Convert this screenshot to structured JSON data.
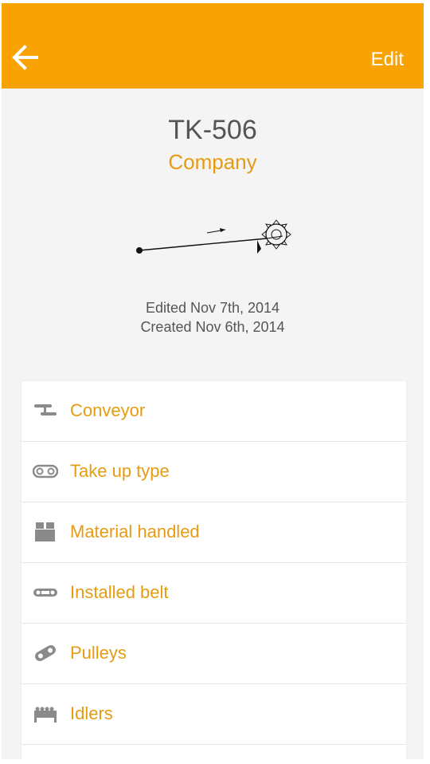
{
  "header": {
    "edit_label": "Edit",
    "background": "#f9a203",
    "back_icon": "arrow-left-icon"
  },
  "equipment": {
    "id": "TK-506",
    "company": "Company",
    "edited": "Edited Nov 7th, 2014",
    "created": "Created Nov 6th, 2014"
  },
  "menu": {
    "items": [
      {
        "label": "Conveyor",
        "icon": "conveyor-icon"
      },
      {
        "label": "Take up type",
        "icon": "take-up-icon"
      },
      {
        "label": "Material handled",
        "icon": "box-icon"
      },
      {
        "label": "Installed belt",
        "icon": "belt-icon"
      },
      {
        "label": "Pulleys",
        "icon": "pulleys-icon"
      },
      {
        "label": "Idlers",
        "icon": "idlers-icon"
      }
    ]
  },
  "colors": {
    "accent": "#f9a203",
    "label": "#e59c12",
    "text": "#555555",
    "icon": "#8a8a8a"
  }
}
